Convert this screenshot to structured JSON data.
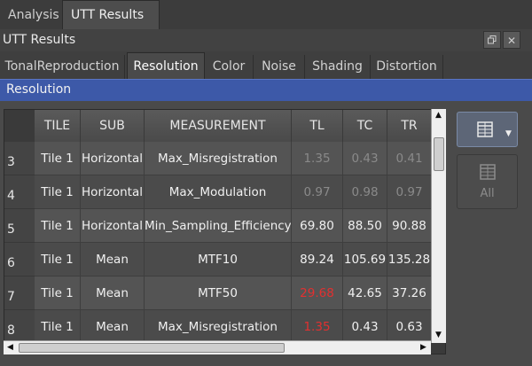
{
  "top_tabs": [
    {
      "label": "Analysis",
      "active": false
    },
    {
      "label": "UTT Results",
      "active": true
    }
  ],
  "panel": {
    "title": "UTT Results"
  },
  "sub_tabs": [
    {
      "label": "TonalReproduction",
      "active": false
    },
    {
      "label": "Resolution",
      "active": true
    },
    {
      "label": "Color",
      "active": false
    },
    {
      "label": "Noise",
      "active": false
    },
    {
      "label": "Shading",
      "active": false
    },
    {
      "label": "Distortion",
      "active": false
    }
  ],
  "section": {
    "title": "Resolution"
  },
  "table": {
    "headers": [
      "TILE",
      "SUB",
      "MEASUREMENT",
      "TL",
      "TC",
      "TR"
    ],
    "rows": [
      {
        "num": "3",
        "tile": "Tile 1",
        "sub": "Horizontal",
        "measurement": "Max_Misregistration",
        "tl": "1.35",
        "tc": "0.43",
        "tr": "0.41"
      },
      {
        "num": "4",
        "tile": "Tile 1",
        "sub": "Horizontal",
        "measurement": "Max_Modulation",
        "tl": "0.97",
        "tc": "0.98",
        "tr": "0.97"
      },
      {
        "num": "5",
        "tile": "Tile 1",
        "sub": "Horizontal",
        "measurement": "Min_Sampling_Efficiency",
        "tl": "69.80",
        "tc": "88.50",
        "tr": "90.88"
      },
      {
        "num": "6",
        "tile": "Tile 1",
        "sub": "Mean",
        "measurement": "MTF10",
        "tl": "89.24",
        "tc": "105.69",
        "tr": "135.28"
      },
      {
        "num": "7",
        "tile": "Tile 1",
        "sub": "Mean",
        "measurement": "MTF50",
        "tl": "29.68",
        "tc": "42.65",
        "tr": "37.26"
      },
      {
        "num": "8",
        "tile": "Tile 1",
        "sub": "Mean",
        "measurement": "Max_Misregistration",
        "tl": "1.35",
        "tc": "0.43",
        "tr": "0.63"
      }
    ]
  },
  "side_buttons": {
    "all_label": "All"
  },
  "colors": {
    "accent": "#3d59a8",
    "flag_red": "#e23030",
    "muted": "#8a8a8a"
  }
}
